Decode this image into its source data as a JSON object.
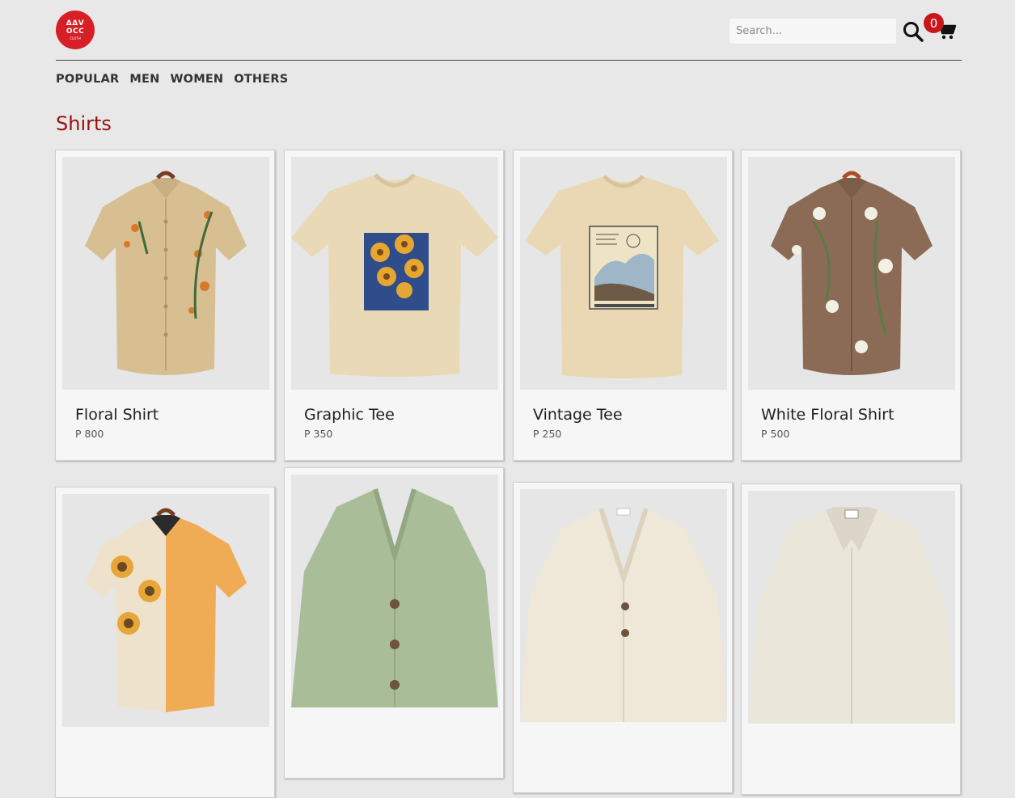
{
  "brand": {
    "logo_line1": "ΔΔV",
    "logo_line2": "OCC",
    "logo_line3": "CLOTH"
  },
  "search": {
    "placeholder": "Search..."
  },
  "cart": {
    "count": "0"
  },
  "nav": [
    {
      "label": "POPULAR"
    },
    {
      "label": "MEN"
    },
    {
      "label": "WOMEN"
    },
    {
      "label": "OTHERS"
    }
  ],
  "section": {
    "title": "Shirts"
  },
  "products": [
    {
      "name": "Floral Shirt",
      "price": "P 800"
    },
    {
      "name": "Graphic Tee",
      "price": "P 350"
    },
    {
      "name": "Vintage Tee",
      "price": "P 250"
    },
    {
      "name": "White Floral Shirt",
      "price": "P 500"
    },
    {
      "name": "",
      "price": ""
    },
    {
      "name": "",
      "price": ""
    },
    {
      "name": "",
      "price": ""
    },
    {
      "name": "",
      "price": ""
    }
  ],
  "colors": {
    "accent": "#9b0f0f",
    "badge": "#c8161d",
    "logo": "#d61f26",
    "background": "#e8e8e8"
  }
}
